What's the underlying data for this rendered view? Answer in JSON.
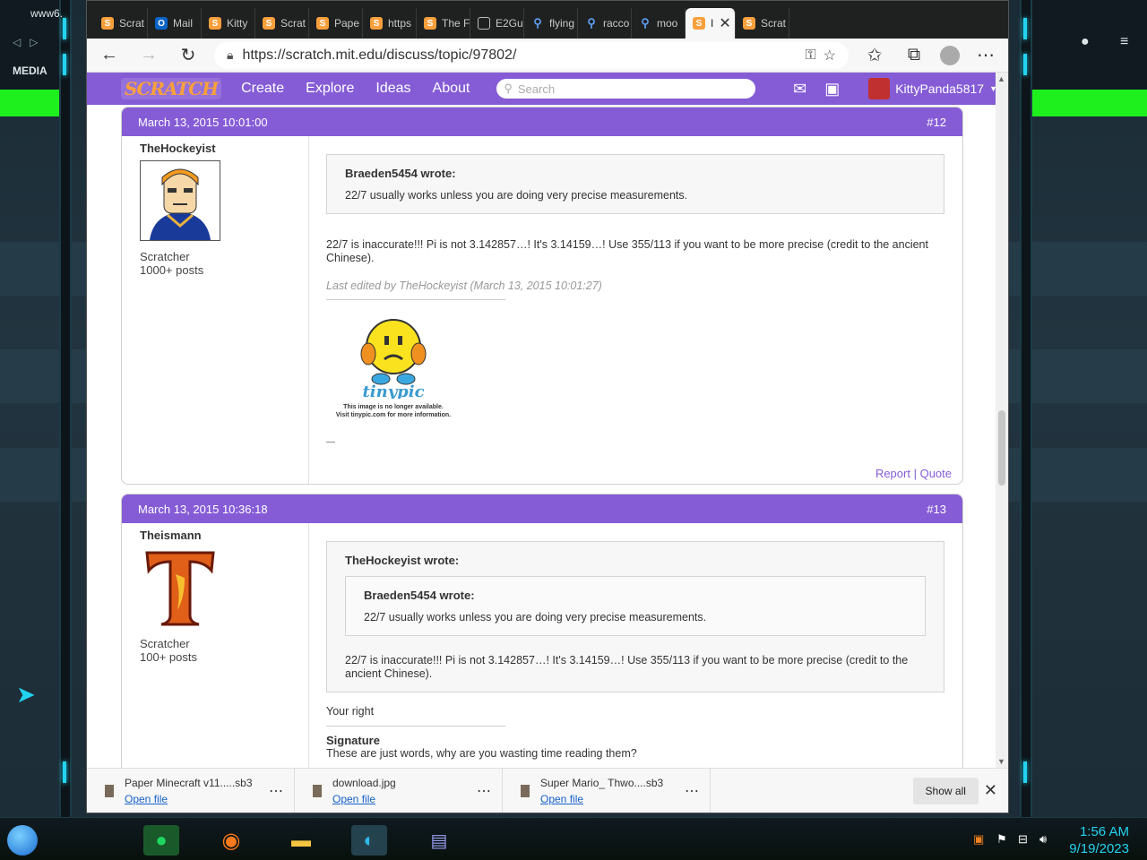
{
  "desktop": {
    "top_left_label": "www6.",
    "media_label": "MEDIA",
    "clock_time": "1:56 AM",
    "clock_date": "9/19/2023"
  },
  "browser": {
    "tabs": [
      {
        "label": "Scrat",
        "icon": "scratch-icon"
      },
      {
        "label": "Mail",
        "icon": "outlook-icon"
      },
      {
        "label": "Kitty",
        "icon": "scratch-icon"
      },
      {
        "label": "Scrat",
        "icon": "scratch-icon"
      },
      {
        "label": "Pape",
        "icon": "scratch-icon"
      },
      {
        "label": "https",
        "icon": "scratch-icon"
      },
      {
        "label": "The F",
        "icon": "scratch-icon"
      },
      {
        "label": "E2Gu",
        "icon": "document-icon"
      },
      {
        "label": "flying",
        "icon": "search-icon"
      },
      {
        "label": "racco",
        "icon": "search-icon"
      },
      {
        "label": "moo",
        "icon": "search-icon"
      },
      {
        "label": "I",
        "icon": "scratch-icon",
        "active": true
      },
      {
        "label": "Scrat",
        "icon": "scratch-icon"
      }
    ],
    "url": "https://scratch.mit.edu/discuss/topic/97802/"
  },
  "scratch_nav": {
    "logo": "SCRATCH",
    "items": [
      "Create",
      "Explore",
      "Ideas",
      "About"
    ],
    "search_placeholder": "Search",
    "username": "KittyPanda5817"
  },
  "posts": [
    {
      "date": "March 13, 2015 10:01:00",
      "number": "#12",
      "username": "TheHockeyist",
      "rank": "Scratcher",
      "post_count": "1000+ posts",
      "quote_author": "Braeden5454 wrote:",
      "quote_text": "22/7 usually works unless you are doing very precise measurements.",
      "body": "22/7 is inaccurate!!! Pi is not 3.142857…! It's 3.14159…! Use 355/113 if you want to be more precise (credit to the ancient Chinese).",
      "edited": "Last edited by TheHockeyist (March 13, 2015 10:01:27)",
      "sig_image_text_1": "This image is no longer available.",
      "sig_image_text_2": "Visit tinypic.com for more information.",
      "sig_image_brand": "tinypic",
      "sig_dash": "—",
      "report": "Report",
      "quote_link": "Quote"
    },
    {
      "date": "March 13, 2015 10:36:18",
      "number": "#13",
      "username": "Theismann",
      "rank": "Scratcher",
      "post_count": "100+ posts",
      "quote_author": "TheHockeyist wrote:",
      "inner_quote_author": "Braeden5454 wrote:",
      "inner_quote_text": "22/7 usually works unless you are doing very precise measurements.",
      "quote_text": "22/7 is inaccurate!!! Pi is not 3.142857…! It's 3.14159…! Use 355/113 if you want to be more precise (credit to the ancient Chinese).",
      "body": "Your right",
      "signature_title": "Signature",
      "signature_text": "These are just words, why are you wasting time reading them?"
    }
  ],
  "downloads": [
    {
      "name": "Paper Minecraft v11.....sb3",
      "action": "Open file"
    },
    {
      "name": "download.jpg",
      "action": "Open file"
    },
    {
      "name": "Super Mario_ Thwo....sb3",
      "action": "Open file"
    }
  ],
  "download_bar": {
    "show_all": "Show all"
  }
}
